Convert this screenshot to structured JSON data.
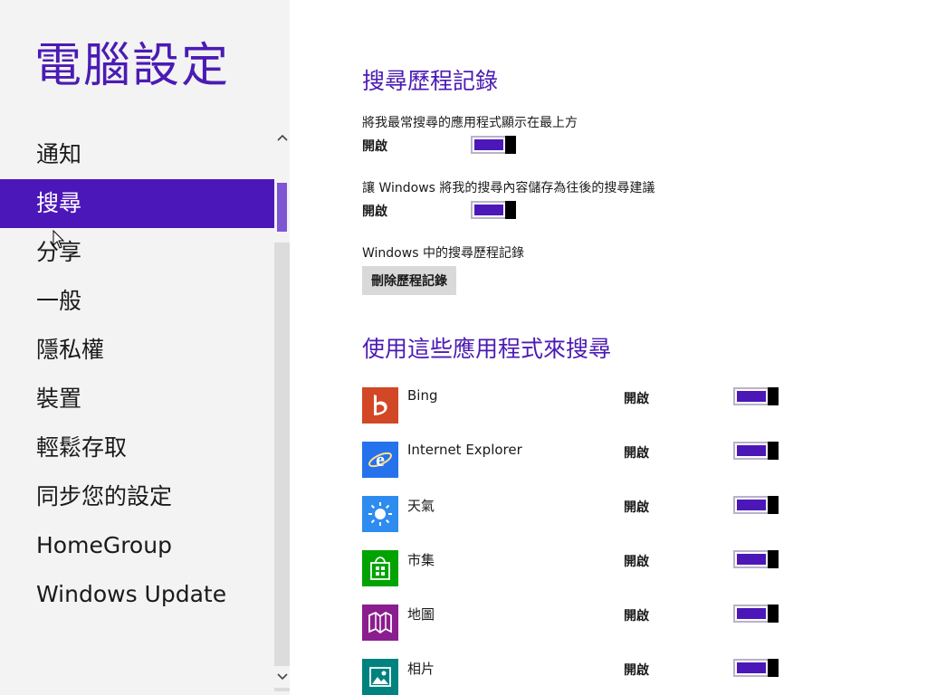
{
  "sidebar": {
    "title": "電腦設定",
    "items": [
      {
        "label": "通知"
      },
      {
        "label": "搜尋"
      },
      {
        "label": "分享"
      },
      {
        "label": "一般"
      },
      {
        "label": "隱私權"
      },
      {
        "label": "裝置"
      },
      {
        "label": "輕鬆存取"
      },
      {
        "label": "同步您的設定"
      },
      {
        "label": "HomeGroup"
      },
      {
        "label": "Windows Update"
      }
    ],
    "selected": "搜尋"
  },
  "search_history": {
    "title": "搜尋歷程記錄",
    "setting1": {
      "desc": "將我最常搜尋的應用程式顯示在最上方",
      "state": "開啟"
    },
    "setting2": {
      "desc": "讓 Windows 將我的搜尋內容儲存為往後的搜尋建議",
      "state": "開啟"
    },
    "history_label": "Windows 中的搜尋歷程記錄",
    "delete_button": "刪除歷程記錄"
  },
  "apps_section": {
    "title": "使用這些應用程式來搜尋",
    "apps": [
      {
        "name": "Bing",
        "state": "開啟",
        "icon": "bing-icon",
        "color": "#d24726"
      },
      {
        "name": "Internet Explorer",
        "state": "開啟",
        "icon": "internet-explorer-icon",
        "color": "#2672ec"
      },
      {
        "name": "天氣",
        "state": "開啟",
        "icon": "weather-sun-icon",
        "color": "#2e8cf0"
      },
      {
        "name": "市集",
        "state": "開啟",
        "icon": "store-icon",
        "color": "#00a300"
      },
      {
        "name": "地圖",
        "state": "開啟",
        "icon": "maps-icon",
        "color": "#8b1e8f"
      },
      {
        "name": "相片",
        "state": "開啟",
        "icon": "photos-icon",
        "color": "#00827f"
      }
    ]
  },
  "colors": {
    "accent": "#4c17b8",
    "title": "#4b1bb4",
    "sidebar_bg": "#f3f3f3"
  }
}
